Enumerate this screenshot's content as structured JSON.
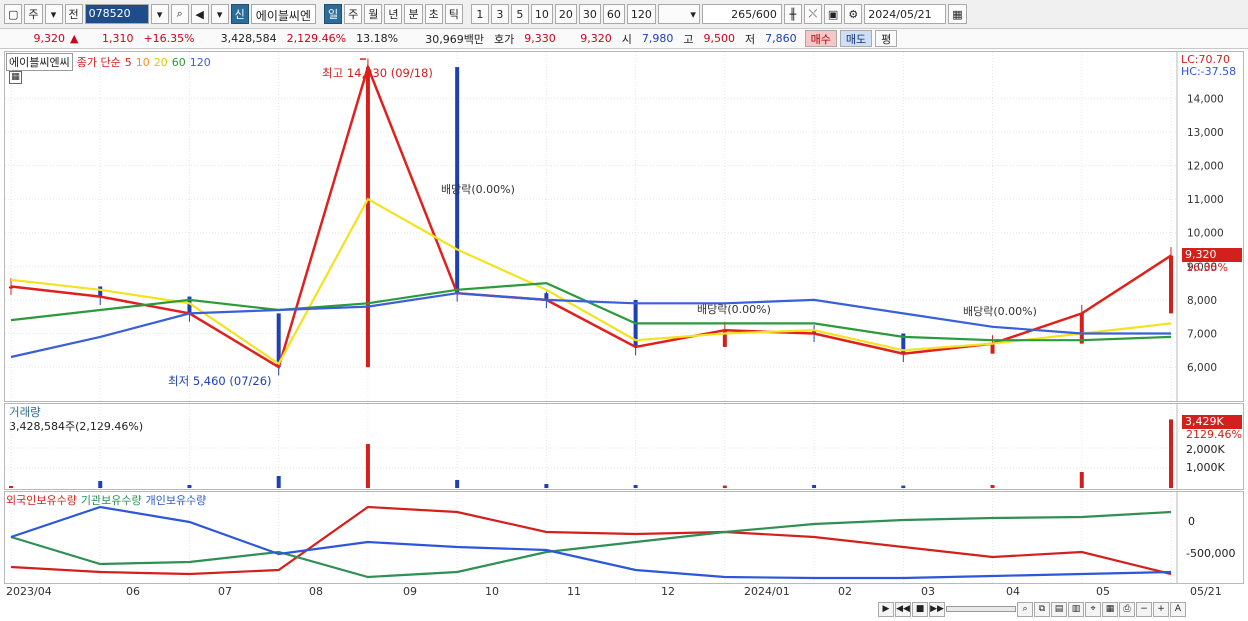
{
  "toolbar": {
    "period_label": "주",
    "prev_label": "전",
    "stock_code": "078520",
    "new_badge": "신",
    "stock_name": "에이블씨엔",
    "period_tabs": [
      "일",
      "주",
      "월",
      "년",
      "분",
      "초",
      "틱"
    ],
    "active_tab": "일",
    "number_tabs": [
      "1",
      "3",
      "5",
      "10",
      "20",
      "30",
      "60",
      "120"
    ],
    "count": "265",
    "count_total": "/600",
    "date": "2024/05/21"
  },
  "quote": {
    "price": "9,320",
    "arrow": "▲",
    "change": "1,310",
    "change_pct": "+16.35%",
    "volume": "3,428,584",
    "volume_pct": "2,129.46%",
    "turnover": "13.18%",
    "amount": "30,969백만",
    "bid_label": "호가",
    "bid1": "9,330",
    "bid2": "9,320",
    "open_label": "시",
    "open": "7,980",
    "high_label": "고",
    "high": "9,500",
    "low_label": "저",
    "low": "7,860",
    "buy_label": "매수",
    "sell_label": "매도",
    "eval_label": "평"
  },
  "price_panel": {
    "stock_name": "에이블씨엔씨",
    "ma_label": "종가 단순",
    "ma_periods": [
      "5",
      "10",
      "20",
      "60",
      "120"
    ],
    "ma_colors": [
      "#e0201c",
      "#ff8c1a",
      "#f3e21d",
      "#2a9a3a",
      "#3a5fd8"
    ],
    "lc": "LC:70.70",
    "hc": "HC:-37.58",
    "y_ticks": [
      "14,000",
      "13,000",
      "12,000",
      "11,000",
      "10,000",
      "9,000",
      "8,000",
      "7,000",
      "6,000"
    ],
    "last_price": "9,320",
    "last_pct": "16.35%",
    "high_annotation": "최고 14,930 (09/18)",
    "low_annotation": "최저 5,460 (07/26)",
    "dividend_labels": [
      "배당락(0.00%)",
      "배당락(0.00%)",
      "배당락(0.00%)"
    ]
  },
  "volume_panel": {
    "title": "거래량",
    "value": "3,428,584주(2,129.46%)",
    "y_ticks": [
      "2,000K",
      "1,000K"
    ],
    "last_value": "3,429K",
    "last_pct": "2129.46%"
  },
  "holding_panel": {
    "title_foreign": "외국인보유수량",
    "title_inst": "기관보유수량",
    "title_indiv": "개인보유수량",
    "colors": {
      "foreign": "#d4201c",
      "inst": "#2f8f55",
      "indiv": "#2d57d8"
    },
    "y_ticks": [
      "0",
      "-500,000"
    ]
  },
  "x_axis": [
    "2023/04",
    "06",
    "07",
    "08",
    "09",
    "10",
    "11",
    "12",
    "2024/01",
    "02",
    "03",
    "04",
    "05",
    "05/21"
  ],
  "chart_data": {
    "type": "line",
    "title": "",
    "ylim": [
      5200,
      15200
    ],
    "x": [
      "2023/04",
      "06",
      "07",
      "08",
      "09",
      "10",
      "11",
      "12",
      "2024/01",
      "02",
      "03",
      "04",
      "05",
      "05/21"
    ],
    "series": [
      {
        "name": "5",
        "values": [
          8400,
          8100,
          7600,
          6000,
          14930,
          8200,
          8000,
          6600,
          7100,
          7000,
          6400,
          6700,
          7600,
          9320
        ]
      },
      {
        "name": "20",
        "values": [
          8600,
          8300,
          7900,
          6100,
          11000,
          9500,
          8300,
          6800,
          7000,
          7100,
          6500,
          6700,
          7000,
          7300
        ]
      },
      {
        "name": "60",
        "values": [
          7400,
          7700,
          8000,
          7700,
          7900,
          8300,
          8500,
          7300,
          7300,
          7300,
          6900,
          6800,
          6800,
          6900
        ]
      },
      {
        "name": "120",
        "values": [
          6300,
          6900,
          7600,
          7700,
          7800,
          8200,
          8000,
          7900,
          7900,
          8000,
          7600,
          7200,
          7000,
          7000
        ]
      }
    ],
    "volume_k": [
      100,
      350,
      150,
      600,
      2200,
      400,
      200,
      150,
      120,
      150,
      120,
      150,
      800,
      3429
    ]
  }
}
